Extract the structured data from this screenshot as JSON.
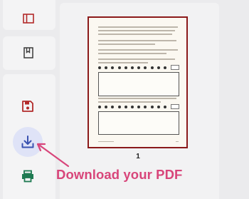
{
  "sidebar": {
    "buttons": [
      {
        "name": "panel-toggle-icon",
        "color": "#b22a2a"
      },
      {
        "name": "bookmark-icon",
        "color": "#3a3a3a"
      },
      {
        "name": "save-icon",
        "color": "#b22a2a"
      },
      {
        "name": "download-icon",
        "color": "#3a52b0",
        "highlight": "#dfe3f7"
      },
      {
        "name": "print-icon",
        "color": "#1f7a52"
      }
    ]
  },
  "preview": {
    "page_number": "1",
    "page_border_color": "#8b1a1a"
  },
  "callout": {
    "text": "Download your PDF",
    "color": "#d8457a"
  }
}
